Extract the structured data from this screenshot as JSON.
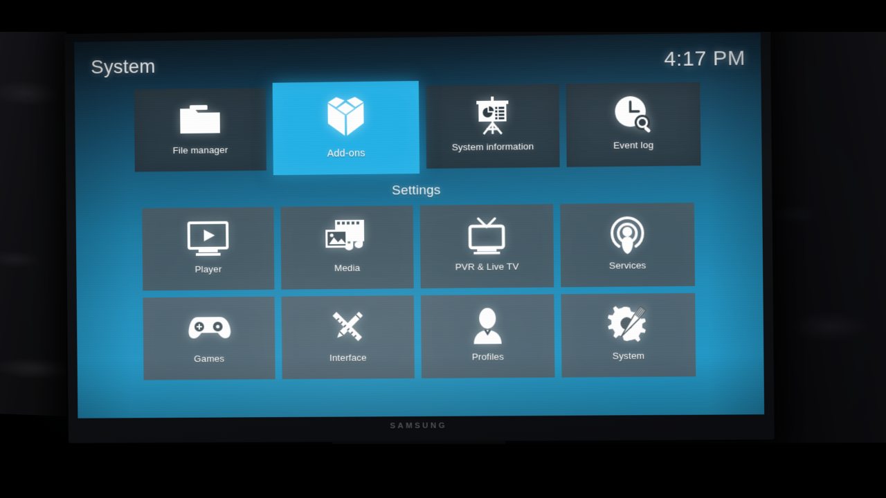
{
  "device": {
    "tv_brand": "SAMSUNG"
  },
  "header": {
    "title": "System",
    "clock": "4:17 PM"
  },
  "colors": {
    "focus_highlight": "#24b2e8",
    "tile_dark": "#2c3942",
    "tile_washed": "#485760",
    "background_top": "#0d1b26",
    "background_bottom": "#2294c1",
    "text": "#ffffff"
  },
  "top_row": {
    "items": [
      {
        "label": "File manager",
        "icon": "folder-icon",
        "focused": false
      },
      {
        "label": "Add-ons",
        "icon": "open-box-icon",
        "focused": true
      },
      {
        "label": "System information",
        "icon": "presentation-chart-icon",
        "focused": false
      },
      {
        "label": "Event log",
        "icon": "clock-search-icon",
        "focused": false
      }
    ]
  },
  "settings": {
    "section_label": "Settings",
    "rows": [
      {
        "items": [
          {
            "label": "Player",
            "icon": "monitor-play-icon",
            "focused": false
          },
          {
            "label": "Media",
            "icon": "media-library-icon",
            "focused": false
          },
          {
            "label": "PVR & Live TV",
            "icon": "tv-antenna-icon",
            "focused": false
          },
          {
            "label": "Services",
            "icon": "broadcast-user-icon",
            "focused": false
          }
        ]
      },
      {
        "items": [
          {
            "label": "Games",
            "icon": "gamepad-icon",
            "focused": false
          },
          {
            "label": "Interface",
            "icon": "pencil-ruler-icon",
            "focused": false
          },
          {
            "label": "Profiles",
            "icon": "user-silhouette-icon",
            "focused": false
          },
          {
            "label": "System",
            "icon": "gear-wrench-icon",
            "focused": false
          }
        ]
      }
    ]
  }
}
